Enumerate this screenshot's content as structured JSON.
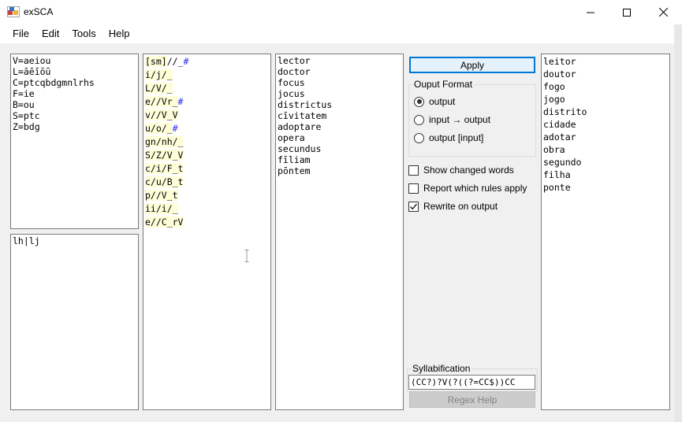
{
  "window": {
    "title": "exSCA"
  },
  "menu": [
    "File",
    "Edit",
    "Tools",
    "Help"
  ],
  "categories": [
    "V=aeiou",
    "L=āēīōū",
    "C=ptcqbdgmnlrhs",
    "F=ie",
    "B=ou",
    "S=ptc",
    "Z=bdg"
  ],
  "rewrite": [
    "lh|lj"
  ],
  "rules": [
    {
      "pre": "",
      "bracket": "[sm]",
      "mid": "//_",
      "env": "",
      "tail": "#",
      "tail_blue": true
    },
    {
      "pre": "i/j/_",
      "env": "V"
    },
    {
      "pre": "L/V/_",
      "env": ""
    },
    {
      "pre": "e//Vr_",
      "env": "",
      "tail": "#",
      "tail_blue": true,
      "hlstart": 3
    },
    {
      "pre": "v//V_V",
      "env": "",
      "hlstart": 3
    },
    {
      "pre": "u/o/_",
      "env": "",
      "tail": "#",
      "tail_blue": true
    },
    {
      "pre": "gn/nh/_",
      "env": ""
    },
    {
      "pre": "S/Z/V_V",
      "env": "",
      "hlstart": 4
    },
    {
      "pre": "c/i/F_t",
      "env": "",
      "hlstart": 4
    },
    {
      "pre": "c/u/B_t",
      "env": "",
      "hlstart": 4
    },
    {
      "pre": "p//V_t",
      "env": "",
      "hlstart": 3
    },
    {
      "pre": "ii/i/_",
      "env": ""
    },
    {
      "pre": "e//C_rV",
      "env": "",
      "hlstart": 3
    }
  ],
  "input_words": [
    "lector",
    "doctor",
    "focus",
    "jocus",
    "districtus",
    "cīvitatem",
    "adoptare",
    "opera",
    "secundus",
    "fīliam",
    "pōntem"
  ],
  "output_words": [
    "leitor",
    "doutor",
    "fogo",
    "jogo",
    "distrito",
    "cidade",
    "adotar",
    "obra",
    "segundo",
    "filha",
    "ponte"
  ],
  "panel": {
    "apply_label": "Apply",
    "output_format_title": "Ouput Format",
    "radio_output": "output",
    "radio_input_output": "input → output",
    "radio_output_input": "output [input]",
    "selected_format": "output",
    "check_show_changed": "Show changed words",
    "check_report_rules": "Report which rules apply",
    "check_rewrite_output": "Rewrite on output",
    "show_changed_checked": false,
    "report_rules_checked": false,
    "rewrite_output_checked": true,
    "syllabification_title": "Syllabification",
    "syllabification_value": "(CC?)?V(?((?=CC$))CC",
    "regex_help_label": "Regex Help"
  }
}
